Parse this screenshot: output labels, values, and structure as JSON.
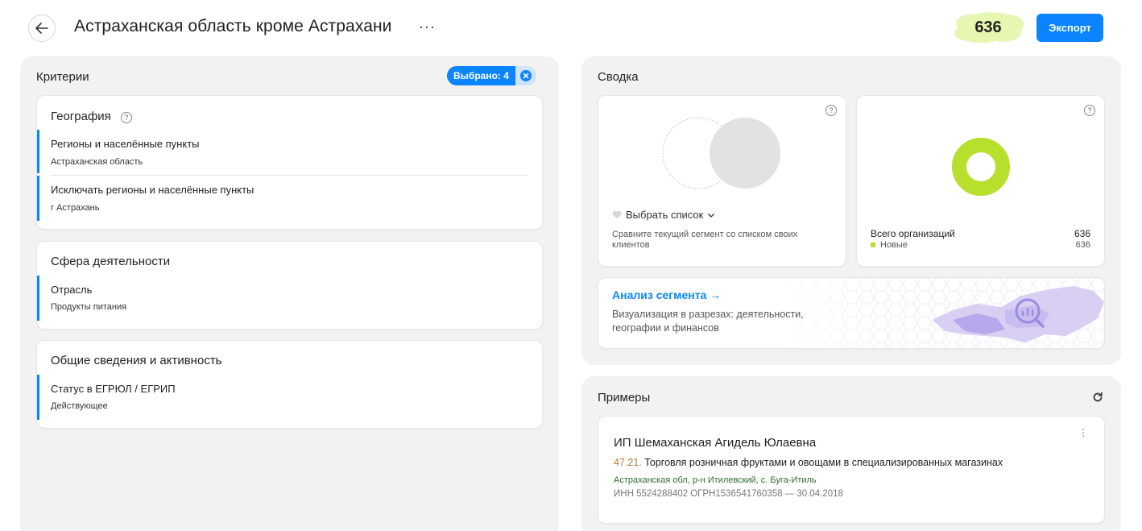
{
  "header": {
    "title": "Астраханская область кроме Астрахани",
    "more": "···",
    "count": "636",
    "export_label": "Экспорт"
  },
  "criteria": {
    "title": "Критерии",
    "selected_label": "Выбрано: 4",
    "groups": [
      {
        "title": "География",
        "items": [
          {
            "label": "Регионы и населённые пункты",
            "value": "Астраханская область"
          },
          {
            "label": "Исключать регионы и населённые пункты",
            "value": "г Астрахань"
          }
        ]
      },
      {
        "title": "Сфера деятельности",
        "items": [
          {
            "label": "Отрасль",
            "value": "Продукты питания"
          }
        ]
      },
      {
        "title": "Общие сведения и активность",
        "items": [
          {
            "label": "Статус в ЕГРЮЛ / ЕГРИП",
            "value": "Действующее"
          }
        ]
      }
    ]
  },
  "summary": {
    "title": "Сводка",
    "compare": {
      "select_label": "Выбрать список",
      "description": "Сравните текущий сегмент со списком своих клиентов"
    },
    "stats": {
      "total_label": "Всего организаций",
      "total_value": "636",
      "new_label": "Новые",
      "new_value": "636",
      "new_share": 1.0,
      "new_color": "#b6e02c"
    },
    "analysis": {
      "title": "Анализ сегмента →",
      "description": "Визуализация в разрезах: деятельности, географии и финансов"
    }
  },
  "examples": {
    "title": "Примеры",
    "item": {
      "name": "ИП Шемаханская Агидель Юлаевна",
      "okved_code": "47.21.",
      "okved_text": " Торговля розничная фруктами и овощами в специализированных магазинах",
      "address": "Астраханская обл, р-н Итилевский, с. Буга-Итиль",
      "ids": "ИНН 5524288402    ОГРН1536541760358 — 30.04.2018"
    }
  },
  "colors": {
    "accent": "#0a84ff",
    "count_badge": "#e5f7b0",
    "new_series": "#b6e02c"
  }
}
